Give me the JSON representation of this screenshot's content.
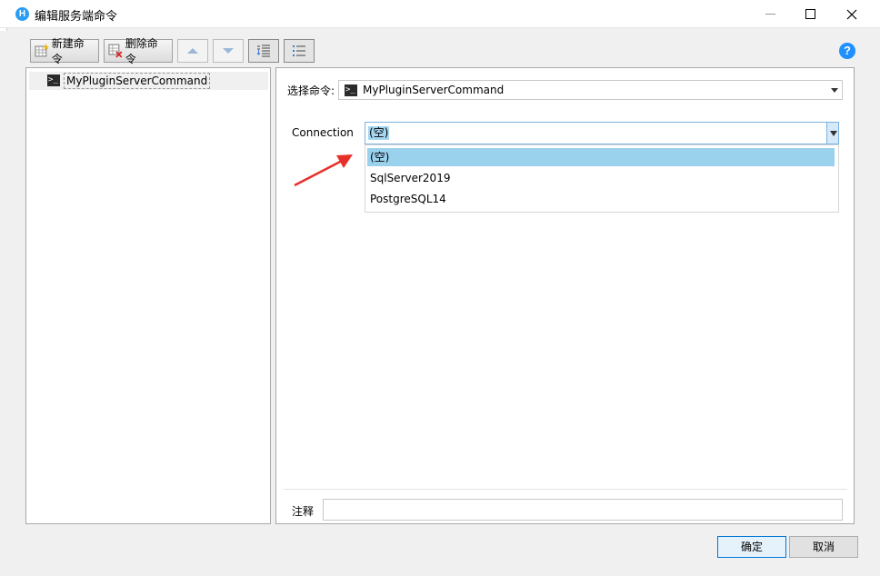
{
  "window": {
    "title": "编辑服务端命令",
    "app_icon_letter": "H"
  },
  "toolbar": {
    "new_label": "新建命令",
    "delete_label": "删除命令",
    "help_label": "?"
  },
  "tree": {
    "items": [
      {
        "label": "MyPluginServerCommand"
      }
    ]
  },
  "form": {
    "select_command_label": "选择命令:",
    "selected_command": "MyPluginServerCommand",
    "connection_label": "Connection",
    "connection_value": "(空)",
    "connection_options": [
      "(空)",
      "SqlServer2019",
      "PostgreSQL14"
    ],
    "note_label": "注释",
    "note_value": ""
  },
  "footer": {
    "ok_label": "确定",
    "cancel_label": "取消"
  },
  "colors": {
    "accent": "#0078d7",
    "highlight": "#9ad2ee",
    "annotation_arrow": "#e8302a"
  }
}
